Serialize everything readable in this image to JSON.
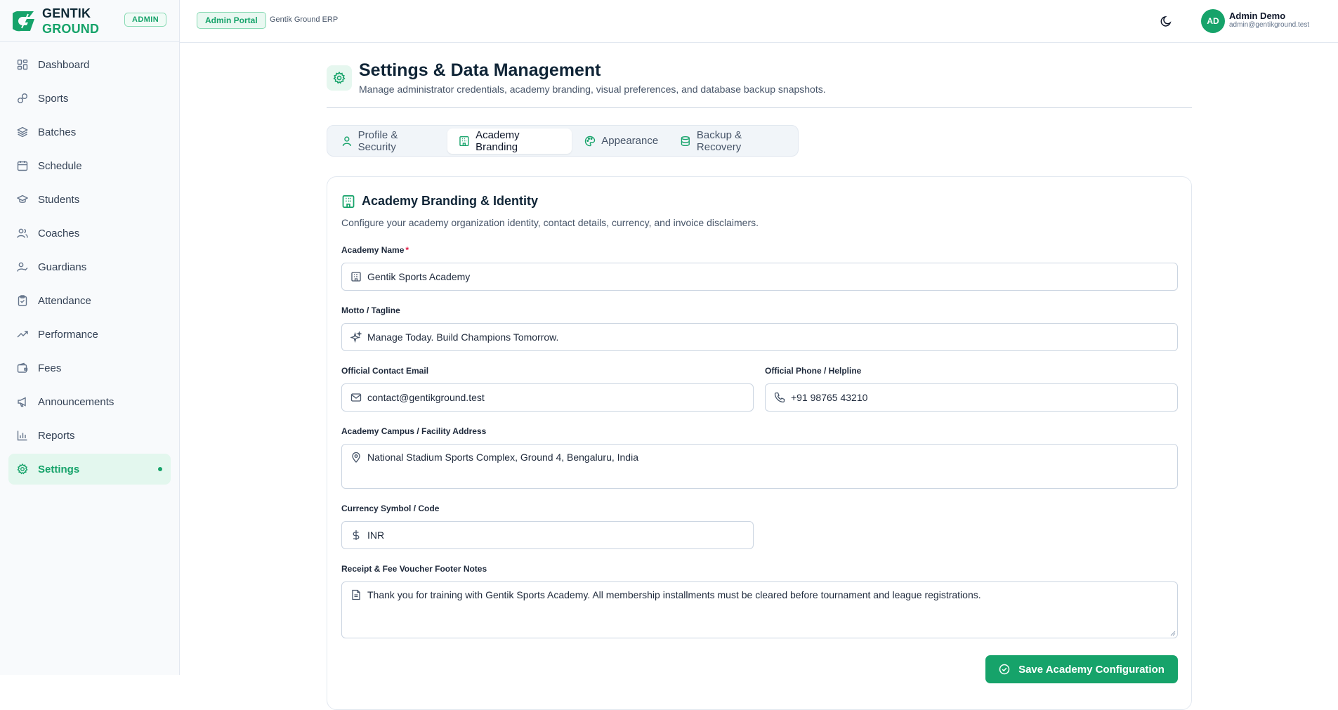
{
  "brand": {
    "line1": "GENTIK",
    "line2": "GROUND",
    "role_badge": "ADMIN"
  },
  "sidebar": {
    "items": [
      {
        "label": "Dashboard",
        "icon": "dashboard-icon"
      },
      {
        "label": "Sports",
        "icon": "sports-icon"
      },
      {
        "label": "Batches",
        "icon": "layers-icon"
      },
      {
        "label": "Schedule",
        "icon": "calendar-icon"
      },
      {
        "label": "Students",
        "icon": "graduation-cap-icon"
      },
      {
        "label": "Coaches",
        "icon": "users-icon"
      },
      {
        "label": "Guardians",
        "icon": "user-check-icon"
      },
      {
        "label": "Attendance",
        "icon": "clipboard-check-icon"
      },
      {
        "label": "Performance",
        "icon": "trending-up-icon"
      },
      {
        "label": "Fees",
        "icon": "wallet-icon"
      },
      {
        "label": "Announcements",
        "icon": "megaphone-icon"
      },
      {
        "label": "Reports",
        "icon": "bar-chart-icon"
      },
      {
        "label": "Settings",
        "icon": "gear-icon",
        "active": true
      }
    ]
  },
  "topbar": {
    "portal_badge": "Admin Portal",
    "portal_sub": "Gentik Ground ERP",
    "user": {
      "initials": "AD",
      "name": "Admin Demo",
      "email": "admin@gentikground.test"
    }
  },
  "page": {
    "title": "Settings & Data Management",
    "subtitle": "Manage administrator credentials, academy branding, visual preferences, and database backup snapshots."
  },
  "tabs": [
    {
      "label": "Profile & Security",
      "icon": "user-icon"
    },
    {
      "label": "Academy Branding",
      "icon": "building-icon",
      "active": true
    },
    {
      "label": "Appearance",
      "icon": "palette-icon"
    },
    {
      "label": "Backup & Recovery",
      "icon": "database-icon"
    }
  ],
  "card": {
    "title": "Academy Branding & Identity",
    "subtitle": "Configure your academy organization identity, contact details, currency, and invoice disclaimers.",
    "fields": {
      "name": {
        "label": "Academy Name",
        "required_mark": "*",
        "value": "Gentik Sports Academy"
      },
      "motto": {
        "label": "Motto / Tagline",
        "value": "Manage Today. Build Champions Tomorrow."
      },
      "email": {
        "label": "Official Contact Email",
        "value": "contact@gentikground.test"
      },
      "phone": {
        "label": "Official Phone / Helpline",
        "value": "+91 98765 43210"
      },
      "address": {
        "label": "Academy Campus / Facility Address",
        "value": "National Stadium Sports Complex, Ground 4, Bengaluru, India"
      },
      "currency": {
        "label": "Currency Symbol / Code",
        "value": "INR"
      },
      "footer": {
        "label": "Receipt & Fee Voucher Footer Notes",
        "value": "Thank you for training with Gentik Sports Academy. All membership installments must be cleared before tournament and league registrations."
      }
    },
    "save_label": "Save Academy Configuration"
  },
  "colors": {
    "accent": "#16a36a",
    "accent_soft": "#e3f7ee",
    "text": "#0f172a",
    "muted": "#475569"
  }
}
